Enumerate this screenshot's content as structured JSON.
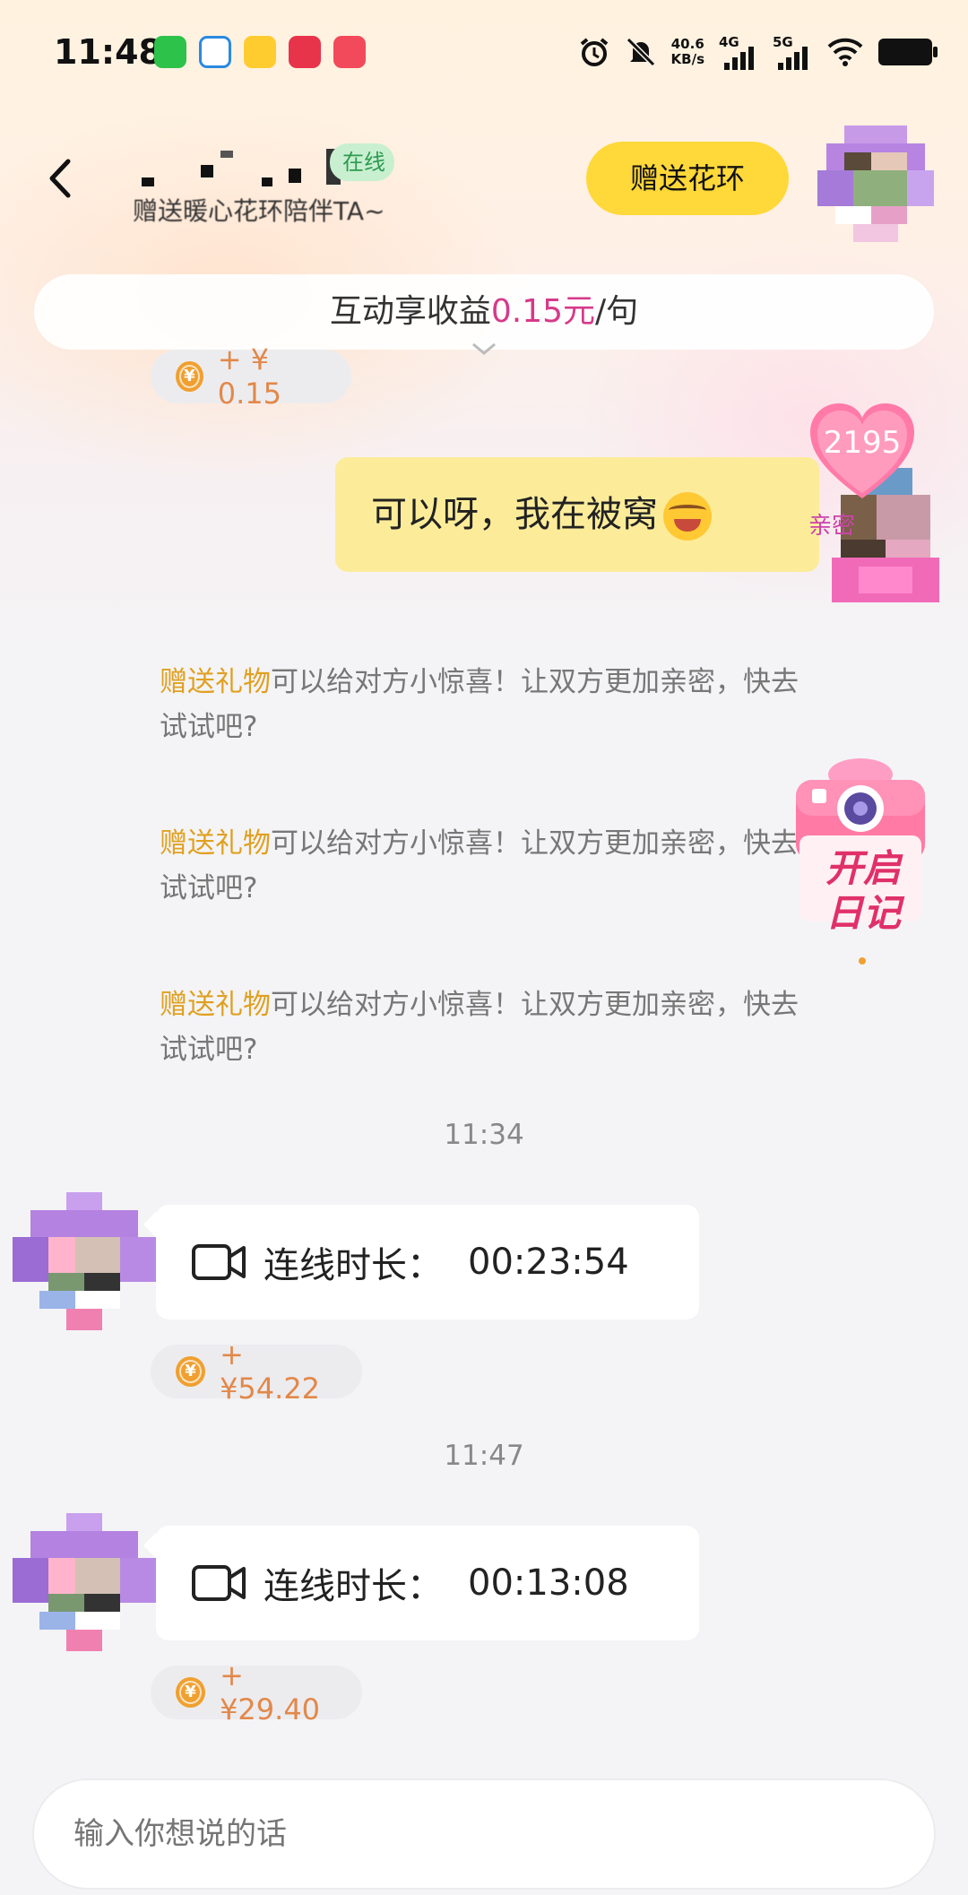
{
  "status_bar": {
    "time": "11:48",
    "net_speed_value": "40.6",
    "net_speed_unit": "KB/s",
    "signal_1": "4G",
    "signal_2": "5G"
  },
  "header": {
    "online_label": "在线",
    "subtitle": "赠送暖心花环陪伴TA~",
    "gift_button": "赠送花环"
  },
  "banner": {
    "prefix": "互动享收益",
    "amount": "0.15元",
    "suffix": "/句"
  },
  "messages": {
    "earning_top": "+ ¥ 0.15",
    "outgoing_text": "可以呀，我在被窝",
    "intimacy": "2195",
    "intimacy_label": "亲密",
    "tips": [
      {
        "highlight": "赠送礼物",
        "text": "可以给对方小惊喜！让双方更加亲密，快去试试吧?"
      },
      {
        "highlight": "赠送礼物",
        "text": "可以给对方小惊喜！让双方更加亲密，快去试试吧?"
      },
      {
        "highlight": "赠送礼物",
        "text": "可以给对方小惊喜！让双方更加亲密，快去试试吧?"
      }
    ],
    "diary_label_line1": "开启",
    "diary_label_line2": "日记",
    "calls": [
      {
        "timestamp": "11:34",
        "label": "连线时长：",
        "duration": "00:23:54",
        "earning": "+¥54.22"
      },
      {
        "timestamp": "11:47",
        "label": "连线时长：",
        "duration": "00:13:08",
        "earning": "+¥29.40"
      }
    ]
  },
  "composer": {
    "placeholder": "输入你想说的话"
  },
  "colors": {
    "gift_button_bg": "#ffd83a",
    "highlight_pink": "#d63a8a",
    "tip_gold": "#e0a020",
    "earning_orange": "#e2884a",
    "outgoing_bubble_bg": "#fcec9a"
  }
}
